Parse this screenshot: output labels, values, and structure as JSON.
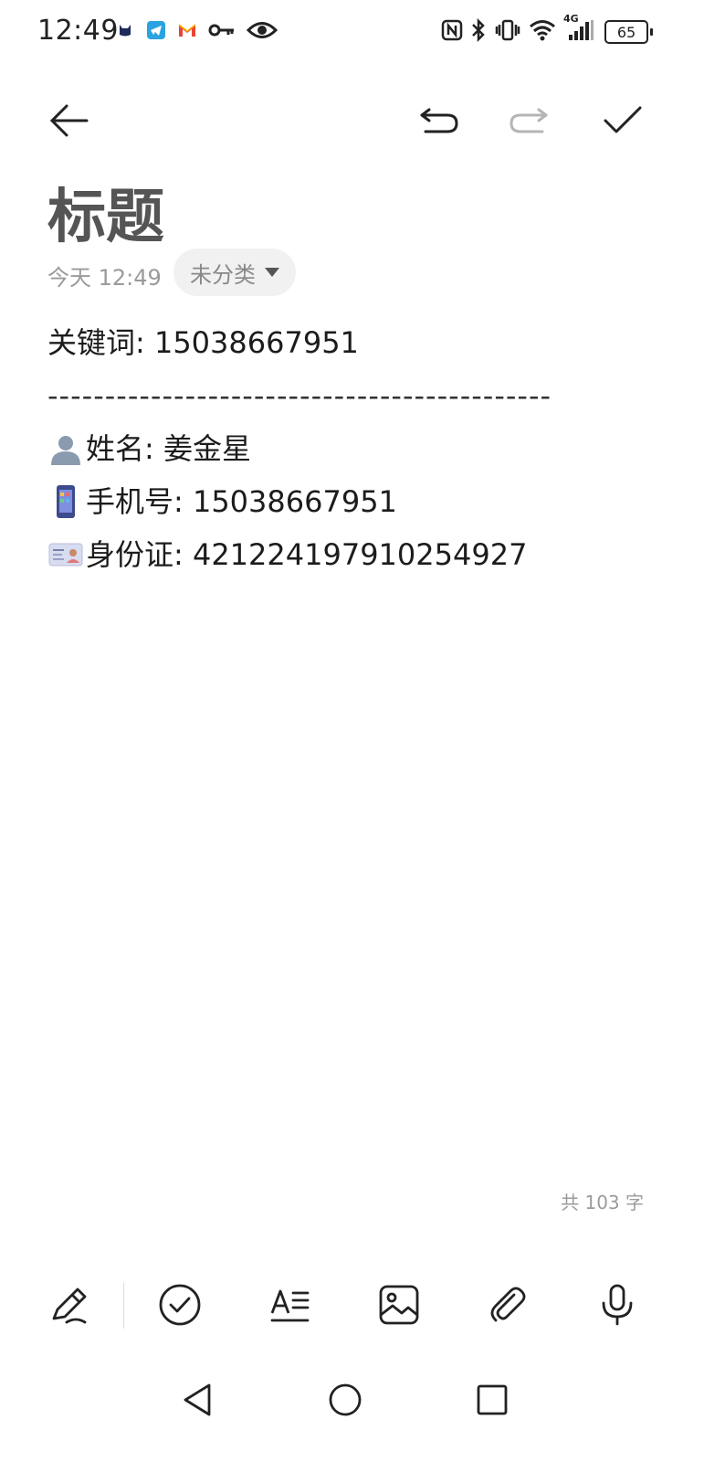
{
  "status_bar": {
    "time": "12:49",
    "battery": "65",
    "notification_icons": [
      "cat-icon",
      "telegram-icon",
      "gmail-icon",
      "key-icon",
      "eye-icon"
    ],
    "system_icons": [
      "nfc-icon",
      "bluetooth-icon",
      "vibrate-icon",
      "wifi-icon",
      "signal-4g-icon"
    ],
    "network_label": "4G"
  },
  "toolbar": {
    "icons": [
      "back-arrow-icon",
      "undo-icon",
      "redo-icon",
      "check-icon"
    ]
  },
  "note": {
    "title": "标题",
    "date": "今天 12:49",
    "category": "未分类",
    "lines": [
      {
        "text": "关键词: 15038667951"
      },
      {
        "text": "--------------------------------------------"
      },
      {
        "emoji": "person-silhouette-icon",
        "text": "姓名: 姜金星"
      },
      {
        "emoji": "mobile-phone-icon",
        "text": "手机号: 15038667951"
      },
      {
        "emoji": "id-card-icon",
        "text": "身份证: 421224197910254927"
      }
    ],
    "word_count": "共 103 字"
  },
  "bottom_toolbar": {
    "icons": [
      "handwriting-pen-icon",
      "checklist-icon",
      "text-format-icon",
      "image-icon",
      "attachment-icon",
      "microphone-icon"
    ]
  },
  "nav_bar": {
    "icons": [
      "nav-back-icon",
      "nav-home-icon",
      "nav-recents-icon"
    ]
  },
  "colors": {
    "title": "#555555",
    "meta": "#9a9a9a",
    "pill_bg": "#f1f1f1",
    "text": "#1c1c1c",
    "disabled_icon": "#b5b5b5"
  }
}
